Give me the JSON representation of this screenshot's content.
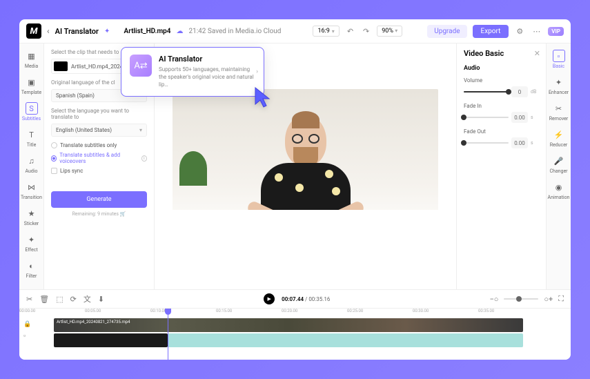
{
  "header": {
    "title": "AI Translator",
    "filename": "Artlist_HD.mp4",
    "saved_time": "21:42",
    "saved_label": "Saved in Media.io Cloud",
    "aspect": "16:9",
    "zoom": "90%",
    "upgrade": "Upgrade",
    "export": "Export",
    "vip": "VIP"
  },
  "left_nav": [
    "Media",
    "Template",
    "Subtitles",
    "Title",
    "Audio",
    "Transition",
    "Sticker",
    "Effect",
    "Filter"
  ],
  "right_nav": [
    "Basic",
    "Enhancer",
    "Remover",
    "Reducer",
    "Changer",
    "Animation"
  ],
  "panel": {
    "select_clip": "Select the clip that needs to",
    "clip_name": "Artlist_HD.mp4_20240",
    "orig_lang_label": "Original language of the cl",
    "orig_lang": "Spanish (Spain)",
    "target_label": "Select the language you want to translate to",
    "target_lang": "English (United States)",
    "opt1": "Translate subtitles only",
    "opt2": "Translate subtitles & add voiceovers",
    "opt3": "Lips sync",
    "generate": "Generate",
    "remaining": "Remaining: 9 minutes"
  },
  "tooltip": {
    "title": "AI Translator",
    "desc": "Supports 50+ languages, maintaining the speaker's original voice and natural lip…"
  },
  "right_panel": {
    "title": "Video Basic",
    "section": "Audio",
    "volume_label": "Volume",
    "volume_val": "0",
    "volume_unit": "dB",
    "fadein_label": "Fade In",
    "fadein_val": "0.00",
    "fadein_unit": "s",
    "fadeout_label": "Fade Out",
    "fadeout_val": "0.00",
    "fadeout_unit": "s"
  },
  "playback": {
    "current": "00:07.44",
    "total": "00:35.16"
  },
  "ruler": [
    "00:00.00",
    "00:05.00",
    "00:10.00",
    "00:15.00",
    "00:20.00",
    "00:25.00",
    "00:30.00",
    "00:35.00"
  ],
  "track_video_label": "Artlist_HD.mp4_20240821_274735.mp4"
}
